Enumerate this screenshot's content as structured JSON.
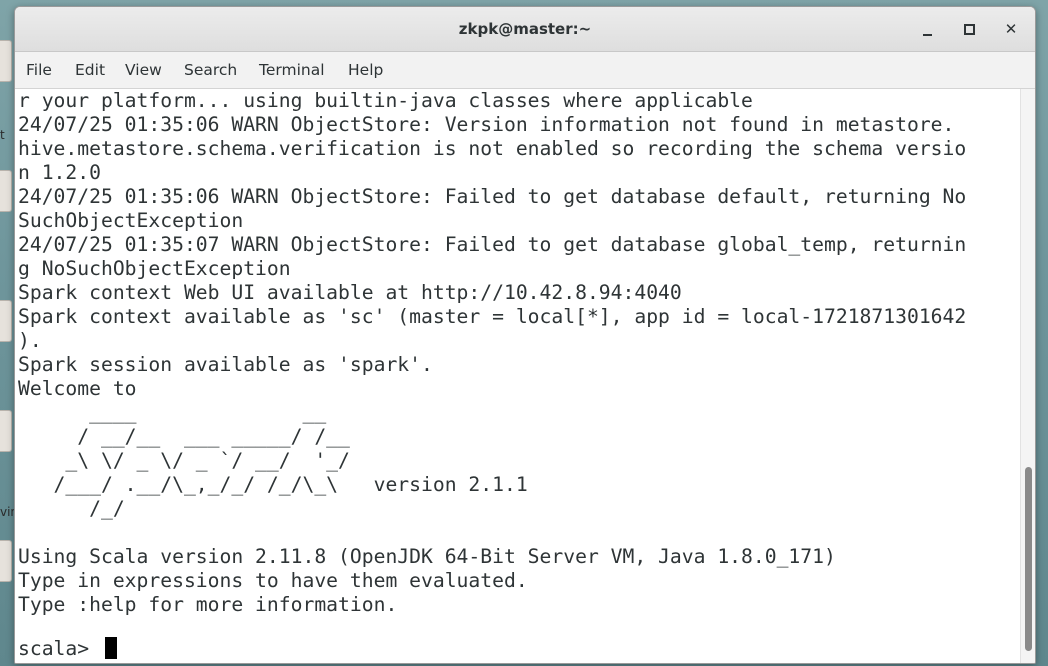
{
  "window": {
    "title": "zkpk@master:~",
    "min_icon": "minimize-icon",
    "max_icon": "maximize-icon",
    "close_icon": "close-icon",
    "close_glyph": "✕"
  },
  "desktop": {
    "partial_labels": [
      "t",
      "vin"
    ]
  },
  "menubar": {
    "items": [
      "File",
      "Edit",
      "View",
      "Search",
      "Terminal",
      "Help"
    ]
  },
  "terminal": {
    "lines": [
      "r your platform... using builtin-java classes where applicable",
      "24/07/25 01:35:06 WARN ObjectStore: Version information not found in metastore.",
      "hive.metastore.schema.verification is not enabled so recording the schema versio",
      "n 1.2.0",
      "24/07/25 01:35:06 WARN ObjectStore: Failed to get database default, returning No",
      "SuchObjectException",
      "24/07/25 01:35:07 WARN ObjectStore: Failed to get database global_temp, returnin",
      "g NoSuchObjectException",
      "Spark context Web UI available at http://10.42.8.94:4040",
      "Spark context available as 'sc' (master = local[*], app id = local-1721871301642",
      ").",
      "Spark session available as 'spark'.",
      "Welcome to",
      "      ____              __",
      "     / __/__  ___ _____/ /__",
      "    _\\ \\/ _ \\/ _ `/ __/  '_/",
      "   /___/ .__/\\_,_/_/ /_/\\_\\   version 2.1.1",
      "      /_/",
      "",
      "Using Scala version 2.11.8 (OpenJDK 64-Bit Server VM, Java 1.8.0_171)",
      "Type in expressions to have them evaluated.",
      "Type :help for more information.",
      "",
      "scala> "
    ]
  },
  "colors": {
    "desktop_bg": "#6f969c",
    "terminal_bg": "#ffffff",
    "terminal_fg": "#2e3436",
    "cursor": "#000000"
  }
}
